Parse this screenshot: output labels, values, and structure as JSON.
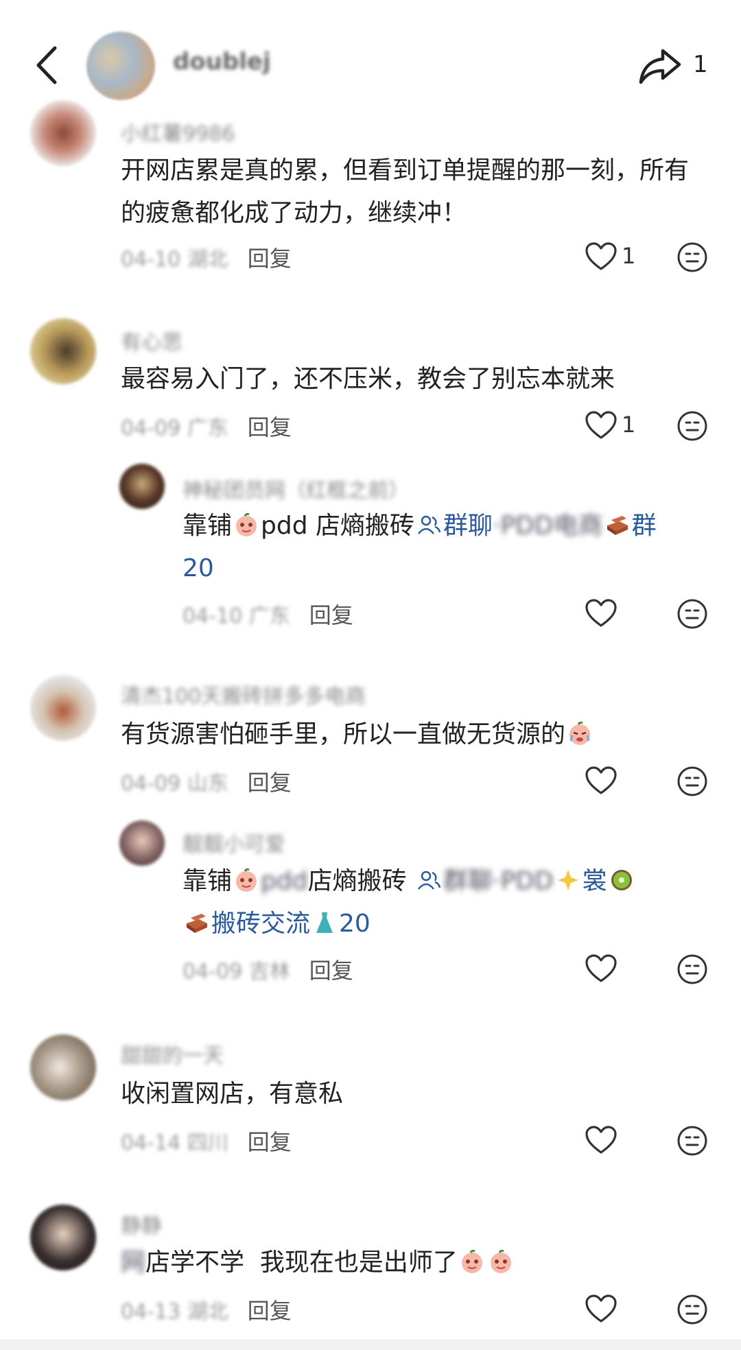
{
  "header": {
    "username": "doublej",
    "share_count": "1"
  },
  "comments": [
    {
      "username": "小红薯9986",
      "text": "开网店累是真的累，但看到订单提醒的那一刻，所有的疲惫都化成了动力，继续冲！",
      "date": "04-10 湖北",
      "reply_label": "回复",
      "likes": "1",
      "avatar_color": "#c98a7a"
    },
    {
      "username": "有心思",
      "text": "最容易入门了，还不压米，教会了别忘本就来",
      "date": "04-09 广东",
      "reply_label": "回复",
      "likes": "1",
      "avatar_color": "#b89a5a"
    },
    {
      "username": "神秘团员网（红框之前）",
      "text_prefix": "靠铺",
      "text_mid": "pdd 店熵搬砖",
      "group_label": "群聊",
      "group_blur": "·PDD电商",
      "text_suffix": "群",
      "text_line2": "20",
      "date": "04-10 广东",
      "reply_label": "回复",
      "avatar_color": "#5a3a2a"
    },
    {
      "username": "清杰100天搬砖拼多多电商",
      "text": "有货源害怕砸手里，所以一直做无货源的",
      "date": "04-09 山东",
      "reply_label": "回复",
      "avatar_color": "#d6c3b0"
    },
    {
      "username": "靓靓小可爱",
      "text_prefix": "靠铺",
      "text_blur": "pdd",
      "text_mid": "店熵搬砖",
      "group_blur": "群聊·PDD",
      "text_after": "裳",
      "text_line2": "搬砖交流",
      "text_line2_num": "20",
      "date": "04-09 吉林",
      "reply_label": "回复",
      "avatar_color": "#8a6a6a"
    },
    {
      "username": "甜甜的一天",
      "text": "收闲置网店，有意私",
      "date": "04-14 四川",
      "reply_label": "回复",
      "avatar_color": "#a89a8a"
    },
    {
      "username": "静静",
      "text_blur": "网",
      "text": "店学不学  我现在也是出师了",
      "date": "04-13 湖北",
      "reply_label": "回复",
      "avatar_color": "#3a3030"
    }
  ]
}
